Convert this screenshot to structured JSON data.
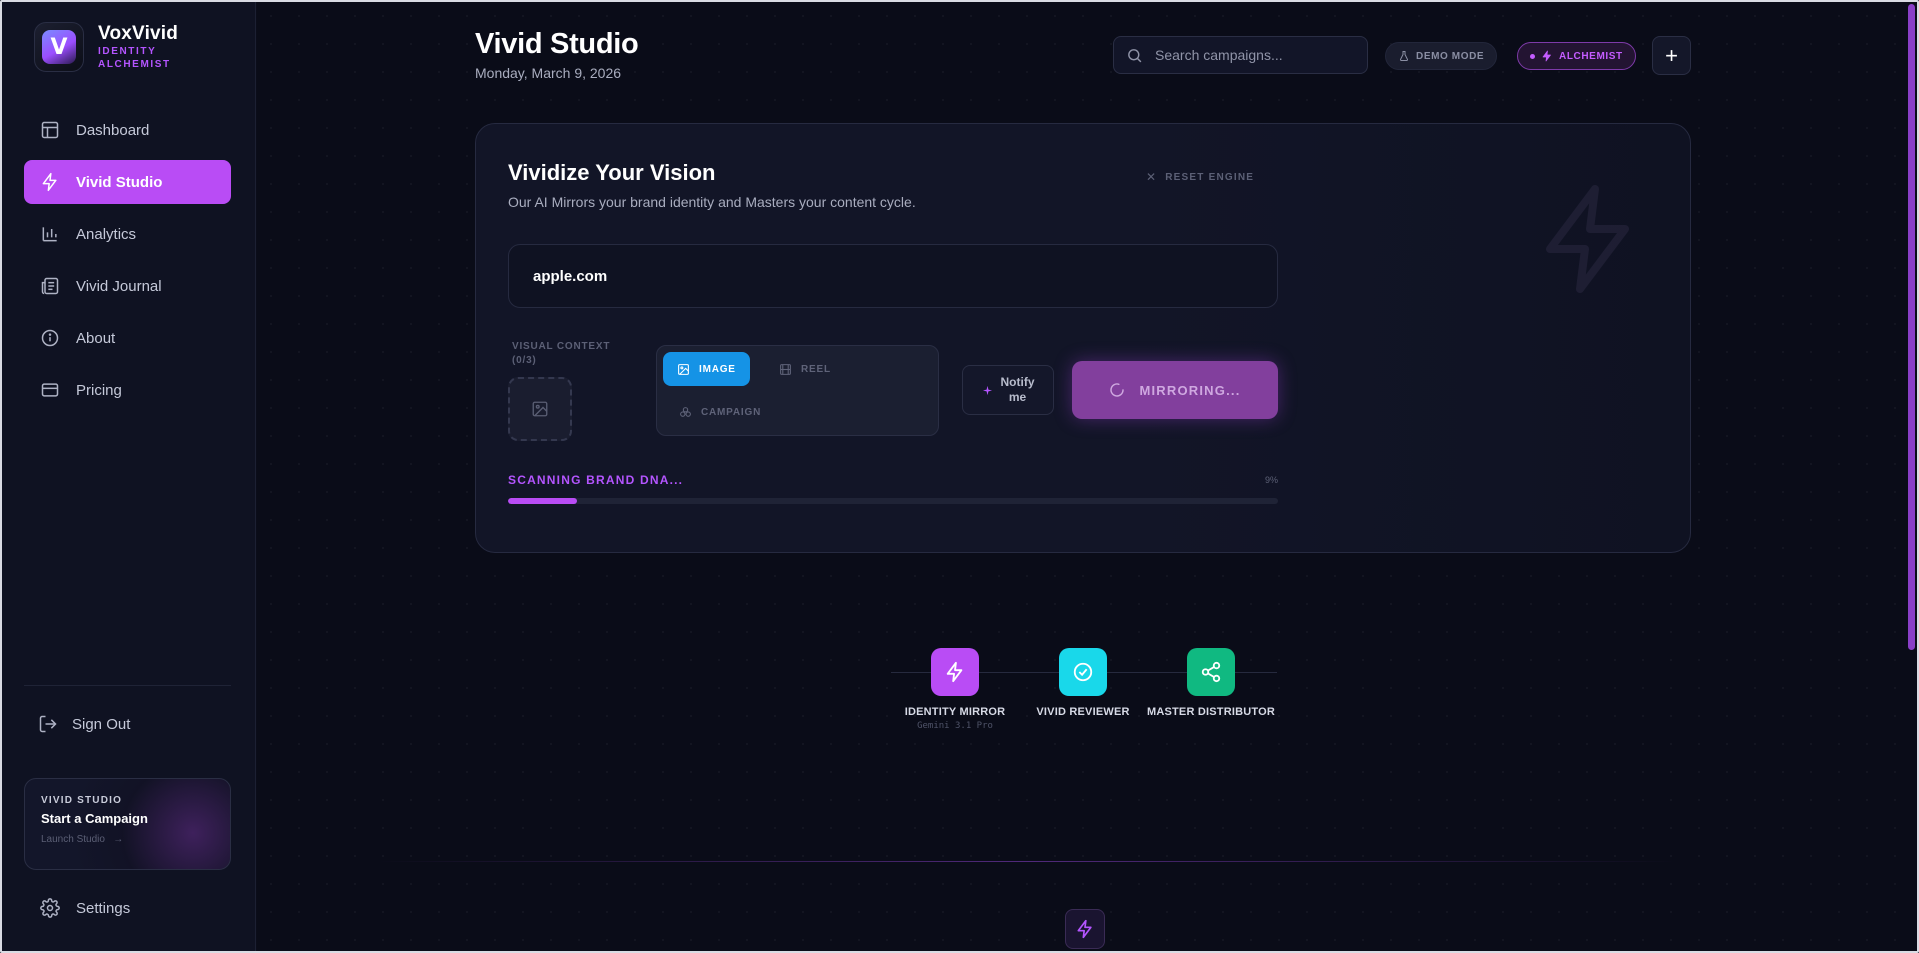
{
  "brand": {
    "name": "VoxVivid",
    "sub_line1": "IDENTITY",
    "sub_line2": "ALCHEMIST",
    "logo_letter": "V"
  },
  "sidebar": {
    "items": [
      {
        "label": "Dashboard",
        "icon": "layout-icon",
        "active": false
      },
      {
        "label": "Vivid Studio",
        "icon": "bolt-icon",
        "active": true
      },
      {
        "label": "Analytics",
        "icon": "bar-chart-icon",
        "active": false
      },
      {
        "label": "Vivid Journal",
        "icon": "newspaper-icon",
        "active": false
      },
      {
        "label": "About",
        "icon": "info-icon",
        "active": false
      },
      {
        "label": "Pricing",
        "icon": "credit-card-icon",
        "active": false
      }
    ],
    "sign_out": "Sign Out",
    "promo": {
      "tag": "VIVID STUDIO",
      "title": "Start a Campaign",
      "link": "Launch Studio"
    },
    "settings": "Settings"
  },
  "header": {
    "title": "Vivid Studio",
    "date": "Monday, March 9, 2026",
    "search_placeholder": "Search campaigns...",
    "demo_mode": "DEMO MODE",
    "plan": "ALCHEMIST",
    "add": "+"
  },
  "studio": {
    "title": "Vividize Your Vision",
    "subtitle": "Our AI Mirrors your brand identity and Masters your content cycle.",
    "reset": "RESET ENGINE",
    "url_value": "apple.com",
    "visual_context_label": "VISUAL CONTEXT",
    "visual_context_count": "(0/3)",
    "modes": [
      {
        "label": "IMAGE",
        "selected": true
      },
      {
        "label": "REEL",
        "selected": false
      },
      {
        "label": "CAMPAIGN",
        "selected": false
      }
    ],
    "notify_line1": "Notify",
    "notify_line2": "me",
    "mirror_button": "MIRRORING...",
    "scan_label": "SCANNING BRAND DNA...",
    "progress_percent": 9,
    "progress_text": "9%"
  },
  "pipeline": [
    {
      "name": "IDENTITY MIRROR",
      "model": "Gemini 3.1 Pro",
      "color": "#b94cf5",
      "icon": "bolt-icon"
    },
    {
      "name": "VIVID REVIEWER",
      "model": "",
      "color": "#19d8ea",
      "icon": "check-circle-icon"
    },
    {
      "name": "MASTER DISTRIBUTOR",
      "model": "",
      "color": "#10b981",
      "icon": "share-icon"
    }
  ],
  "colors": {
    "accent": "#b94cf5",
    "image_mode": "#1593e6",
    "background": "#0a0c18"
  }
}
